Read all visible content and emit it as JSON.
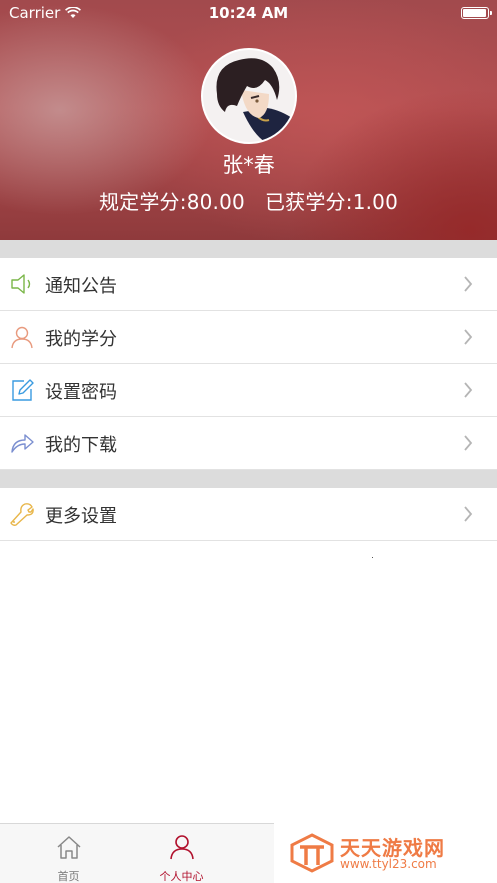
{
  "status_bar": {
    "carrier": "Carrier",
    "time": "10:24 AM"
  },
  "profile": {
    "name": "张*春",
    "required_credits": "规定学分:80.00",
    "earned_credits": "已获学分:1.00"
  },
  "menu": [
    {
      "label": "通知公告",
      "icon": "speaker-icon",
      "color": "#7ab648"
    },
    {
      "label": "我的学分",
      "icon": "person-icon",
      "color": "#e89a7e"
    },
    {
      "label": "设置密码",
      "icon": "edit-icon",
      "color": "#3a9be0"
    },
    {
      "label": "我的下载",
      "icon": "share-arrow-icon",
      "color": "#7b8fd0"
    }
  ],
  "menu2": [
    {
      "label": "更多设置",
      "icon": "wrench-icon",
      "color": "#e8b64a"
    }
  ],
  "tabbar": {
    "tabs": [
      {
        "label": "首页",
        "icon": "home-icon",
        "active": false
      },
      {
        "label": "个人中心",
        "icon": "person-icon",
        "active": true
      }
    ],
    "active_color": "#b1112d"
  },
  "watermark": {
    "title": "天天游戏网",
    "url": "www.ttyl23.com"
  }
}
